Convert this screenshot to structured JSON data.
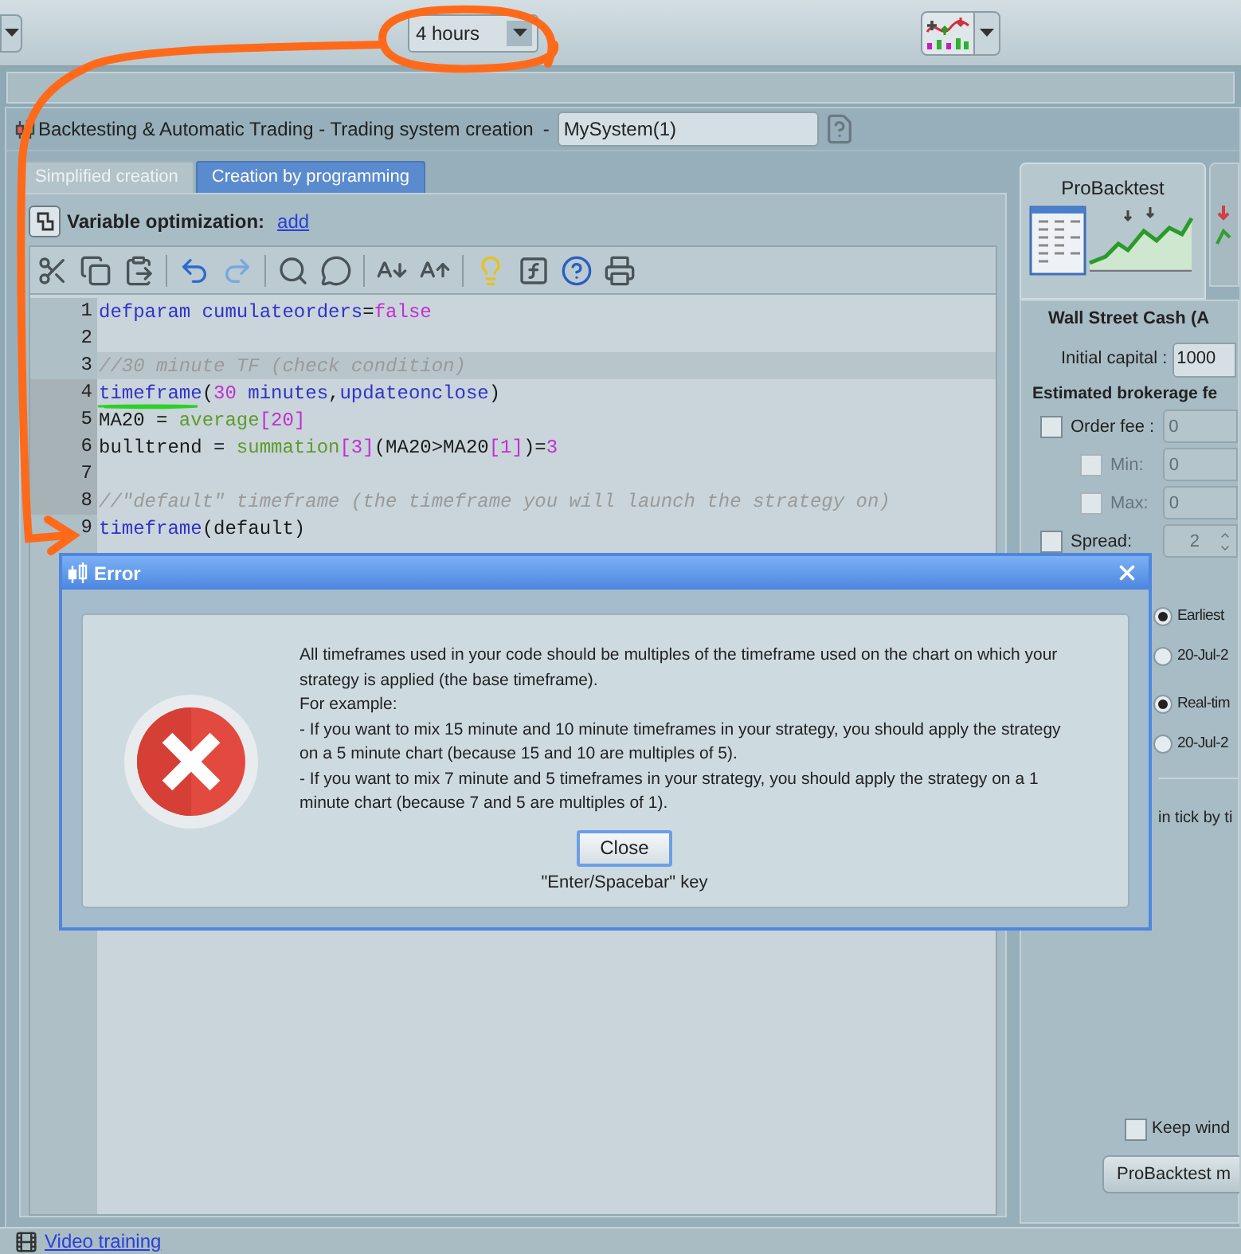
{
  "toolbar": {
    "period_dropdown": {
      "value": "4 hours"
    }
  },
  "window": {
    "title": "Backtesting & Automatic Trading - Trading system creation",
    "separator": "-",
    "system_name": "MySystem(1)"
  },
  "tabs": [
    {
      "label": "Simplified creation",
      "selected": false
    },
    {
      "label": "Creation by programming",
      "selected": true
    }
  ],
  "variable_optimization": {
    "label": "Variable optimization:",
    "link": "add"
  },
  "code": {
    "lines": [
      {
        "number": "1",
        "highlighted": false,
        "marked": false,
        "tokens": [
          {
            "kind": "keyword",
            "text": "defparam cumulateorders"
          },
          {
            "kind": "plain",
            "text": "="
          },
          {
            "kind": "number",
            "text": "false"
          }
        ]
      },
      {
        "number": "2",
        "highlighted": false,
        "marked": false
      },
      {
        "number": "3",
        "highlighted": true,
        "marked": false,
        "tokens": [
          {
            "kind": "comment",
            "text": "//30 minute TF (check condition)"
          }
        ]
      },
      {
        "number": "4",
        "highlighted": false,
        "marked": true,
        "tokens": [
          {
            "kind": "keyword",
            "text": "timeframe"
          },
          {
            "kind": "plain",
            "text": "("
          },
          {
            "kind": "number",
            "text": "30"
          },
          {
            "kind": "keyword",
            "text": " minutes"
          },
          {
            "kind": "plain",
            "text": ","
          },
          {
            "kind": "keyword",
            "text": "updateonclose"
          },
          {
            "kind": "plain",
            "text": ")"
          }
        ]
      },
      {
        "number": "5",
        "highlighted": false,
        "marked": true,
        "tokens": [
          {
            "kind": "plain",
            "text": "MA20 = "
          },
          {
            "kind": "function",
            "text": "average"
          },
          {
            "kind": "number",
            "text": "[20]"
          }
        ]
      },
      {
        "number": "6",
        "highlighted": false,
        "marked": true,
        "tokens": [
          {
            "kind": "plain",
            "text": "bulltrend = "
          },
          {
            "kind": "function",
            "text": "summation"
          },
          {
            "kind": "number",
            "text": "[3]"
          },
          {
            "kind": "plain",
            "text": "(MA20>MA20"
          },
          {
            "kind": "number",
            "text": "[1]"
          },
          {
            "kind": "plain",
            "text": ")="
          },
          {
            "kind": "number",
            "text": "3"
          }
        ]
      },
      {
        "number": "7",
        "highlighted": false,
        "marked": true
      },
      {
        "number": "8",
        "highlighted": false,
        "marked": true,
        "tokens": [
          {
            "kind": "comment",
            "text": "//\"default\" timeframe (the timeframe you will launch the strategy on)"
          }
        ]
      },
      {
        "number": "9",
        "highlighted": false,
        "marked": false,
        "tokens": [
          {
            "kind": "keyword",
            "text": "timeframe"
          },
          {
            "kind": "plain",
            "text": "(default)"
          }
        ]
      }
    ]
  },
  "backtest_panel": {
    "tab_label": "ProBacktest",
    "instrument": "Wall Street Cash (A",
    "initial_capital": {
      "label": "Initial capital :",
      "value": "1000"
    },
    "brokerage_title": "Estimated brokerage fe",
    "fees": [
      {
        "kind": "main",
        "label": "Order fee :",
        "value": "0",
        "checked": false
      },
      {
        "kind": "sub",
        "label": "Min:",
        "value": "0",
        "checked": false
      },
      {
        "kind": "sub",
        "label": "Max:",
        "value": "0",
        "checked": false
      },
      {
        "kind": "main",
        "label": "Spread:",
        "value": "2",
        "checked": false
      }
    ],
    "start_options": [
      {
        "label": "Earliest",
        "selected": true
      },
      {
        "label": "20-Jul-2",
        "selected": false
      }
    ],
    "end_options": [
      {
        "label": "Real-tim",
        "selected": true
      },
      {
        "label": "20-Jul-2",
        "selected": false
      }
    ],
    "tick_note": "in tick by ti",
    "keep_window": {
      "label": "Keep wind",
      "checked": false
    },
    "run_button": "ProBacktest m"
  },
  "dialog": {
    "title": "Error",
    "paragraphs": [
      "All timeframes used in your code should be multiples of the timeframe used on the chart on which your strategy is applied (the base timeframe).",
      "For example:",
      "- If you want to mix 15 minute and 10 minute timeframes in your strategy, you should apply the strategy on a 5 minute chart (because 15 and 10 are multiples of 5).",
      "- If you want to mix 7 minute and 5 timeframes in your strategy, you should apply the strategy on a 1 minute chart (because 7 and 5 are multiples of 1)."
    ],
    "button": "Close",
    "hint": "\"Enter/Spacebar\" key"
  },
  "status_bar": {
    "link": "Video training"
  }
}
